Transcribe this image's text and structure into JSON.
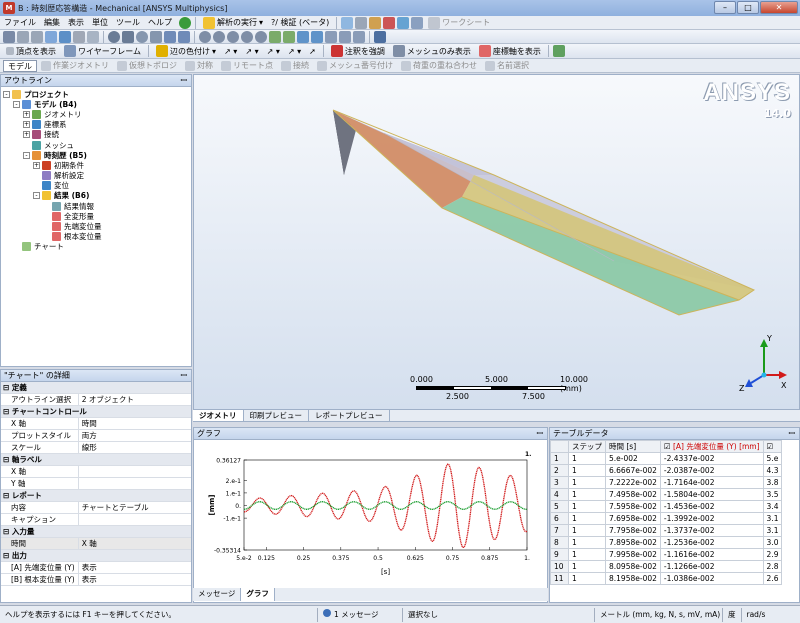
{
  "window": {
    "title": "B : 時刻歴応答構造 - Mechanical [ANSYS Multiphysics]",
    "app_icon": "M"
  },
  "menu": [
    "ファイル",
    "編集",
    "表示",
    "単位",
    "ツール",
    "ヘルプ"
  ],
  "toolbar1": {
    "solve_label": "解析の実行",
    "probe_label": "?/ 検証 (ベータ)",
    "worksheet_label": "ワークシート"
  },
  "toolbar3": {
    "show_vertex": "頂点を表示",
    "wireframe": "ワイヤーフレーム",
    "edge_color": "辺の色付け",
    "annotation": "注釈を強調",
    "mesh_only": "メッシュのみ表示",
    "show_axes": "座標軸を表示"
  },
  "ctxbar": {
    "model_tab": "モデル",
    "items": [
      "作業ジオメトリ",
      "仮想トポロジ",
      "対称",
      "リモート点",
      "接続",
      "メッシュ番号付け",
      "荷重の重ね合わせ",
      "名前選択"
    ]
  },
  "outline": {
    "title": "アウトライン",
    "nodes": [
      {
        "label": "プロジェクト",
        "level": 0,
        "exp": "-",
        "icon": "#f2c14e",
        "bold": true
      },
      {
        "label": "モデル (B4)",
        "level": 1,
        "exp": "-",
        "icon": "#5b8fd6",
        "bold": true
      },
      {
        "label": "ジオメトリ",
        "level": 2,
        "exp": "+",
        "icon": "#6aa84f"
      },
      {
        "label": "座標系",
        "level": 2,
        "exp": "+",
        "icon": "#3d85c6"
      },
      {
        "label": "接続",
        "level": 2,
        "exp": "+",
        "icon": "#a64d79"
      },
      {
        "label": "メッシュ",
        "level": 2,
        "exp": "",
        "icon": "#4ba3a3"
      },
      {
        "label": "時刻歴 (B5)",
        "level": 2,
        "exp": "-",
        "icon": "#e69138",
        "bold": true
      },
      {
        "label": "初期条件",
        "level": 3,
        "exp": "+",
        "icon": "#cc4125"
      },
      {
        "label": "解析設定",
        "level": 3,
        "exp": "",
        "icon": "#8e7cc3"
      },
      {
        "label": "変位",
        "level": 3,
        "exp": "",
        "icon": "#3d85c6"
      },
      {
        "label": "結果 (B6)",
        "level": 3,
        "exp": "-",
        "icon": "#f1c232",
        "bold": true
      },
      {
        "label": "結果情報",
        "level": 4,
        "exp": "",
        "icon": "#76a5af"
      },
      {
        "label": "全変形量",
        "level": 4,
        "exp": "",
        "icon": "#e06666"
      },
      {
        "label": "先端変位量",
        "level": 4,
        "exp": "",
        "icon": "#e06666"
      },
      {
        "label": "根本変位量",
        "level": 4,
        "exp": "",
        "icon": "#e06666"
      },
      {
        "label": "チャート",
        "level": 1,
        "exp": "",
        "icon": "#93c47d"
      }
    ]
  },
  "details": {
    "title": "\"チャート\" の詳細",
    "rows": [
      {
        "type": "grp",
        "k": "定義"
      },
      {
        "k": "アウトライン選択",
        "v": "2 オブジェクト"
      },
      {
        "type": "grp",
        "k": "チャートコントロール"
      },
      {
        "k": "X 軸",
        "v": "時間"
      },
      {
        "k": "プロットスタイル",
        "v": "両方"
      },
      {
        "k": "スケール",
        "v": "線形"
      },
      {
        "type": "grp",
        "k": "軸ラベル"
      },
      {
        "k": "X 軸",
        "v": ""
      },
      {
        "k": "Y 軸",
        "v": ""
      },
      {
        "type": "grp",
        "k": "レポート"
      },
      {
        "k": "内容",
        "v": "チャートとテーブル"
      },
      {
        "k": "キャプション",
        "v": ""
      },
      {
        "type": "grp",
        "k": "入力量"
      },
      {
        "k": "時間",
        "v": "X 軸",
        "sel": true
      },
      {
        "type": "grp",
        "k": "出力"
      },
      {
        "k": "[A] 先端変位量 (Y)",
        "v": "表示"
      },
      {
        "k": "[B] 根本変位量 (Y)",
        "v": "表示"
      }
    ]
  },
  "viewport": {
    "logo": "ANSYS",
    "version": "14.0",
    "scale_top": [
      "0.000",
      "5.000",
      "10.000 (mm)"
    ],
    "scale_bottom": [
      "2.500",
      "7.500"
    ],
    "axes": {
      "x": "X",
      "y": "Y",
      "z": "Z"
    }
  },
  "view_tabs": [
    "ジオメトリ",
    "印刷プレビュー",
    "レポートプレビュー"
  ],
  "graph": {
    "title": "グラフ",
    "ylabel": "[mm]",
    "xlabel": "[s]",
    "yticks": [
      "0.36127",
      "2.e-1",
      "1.e-1",
      "0.",
      "-1.e-1",
      "-0.35314"
    ],
    "xticks": [
      "5.e-2",
      "0.125",
      "0.25",
      "0.375",
      "0.5",
      "0.625",
      "0.75",
      "0.875",
      "1."
    ],
    "corner_label": "1.",
    "red_color": "#d11818",
    "green_color": "#169c2c"
  },
  "graph_tabs": [
    "メッセージ",
    "グラフ"
  ],
  "table": {
    "title": "テーブルデータ",
    "headers": [
      "ステップ",
      "時間 [s]",
      "[A] 先端変位量 (Y) [mm]",
      ""
    ],
    "rows": [
      [
        "1",
        "1",
        "5.e-002",
        "-2.4337e-002",
        "5.e"
      ],
      [
        "2",
        "1",
        "6.6667e-002",
        "-2.0387e-002",
        "4.3"
      ],
      [
        "3",
        "1",
        "7.2222e-002",
        "-1.7164e-002",
        "3.8"
      ],
      [
        "4",
        "1",
        "7.4958e-002",
        "-1.5804e-002",
        "3.5"
      ],
      [
        "5",
        "1",
        "7.5958e-002",
        "-1.4536e-002",
        "3.4"
      ],
      [
        "6",
        "1",
        "7.6958e-002",
        "-1.3992e-002",
        "3.1"
      ],
      [
        "7",
        "1",
        "7.7958e-002",
        "-1.3737e-002",
        "3.1"
      ],
      [
        "8",
        "1",
        "7.8958e-002",
        "-1.2536e-002",
        "3.0"
      ],
      [
        "9",
        "1",
        "7.9958e-002",
        "-1.1616e-002",
        "2.9"
      ],
      [
        "10",
        "1",
        "8.0958e-002",
        "-1.1266e-002",
        "2.8"
      ],
      [
        "11",
        "1",
        "8.1958e-002",
        "-1.0386e-002",
        "2.6"
      ]
    ]
  },
  "status": {
    "help": "ヘルプを表示するには F1 キーを押してください。",
    "messages": "1 メッセージ",
    "selection": "選択なし",
    "units": "メートル (mm, kg, N, s, mV, mA)",
    "angle": "度",
    "rate": "rad/s"
  }
}
